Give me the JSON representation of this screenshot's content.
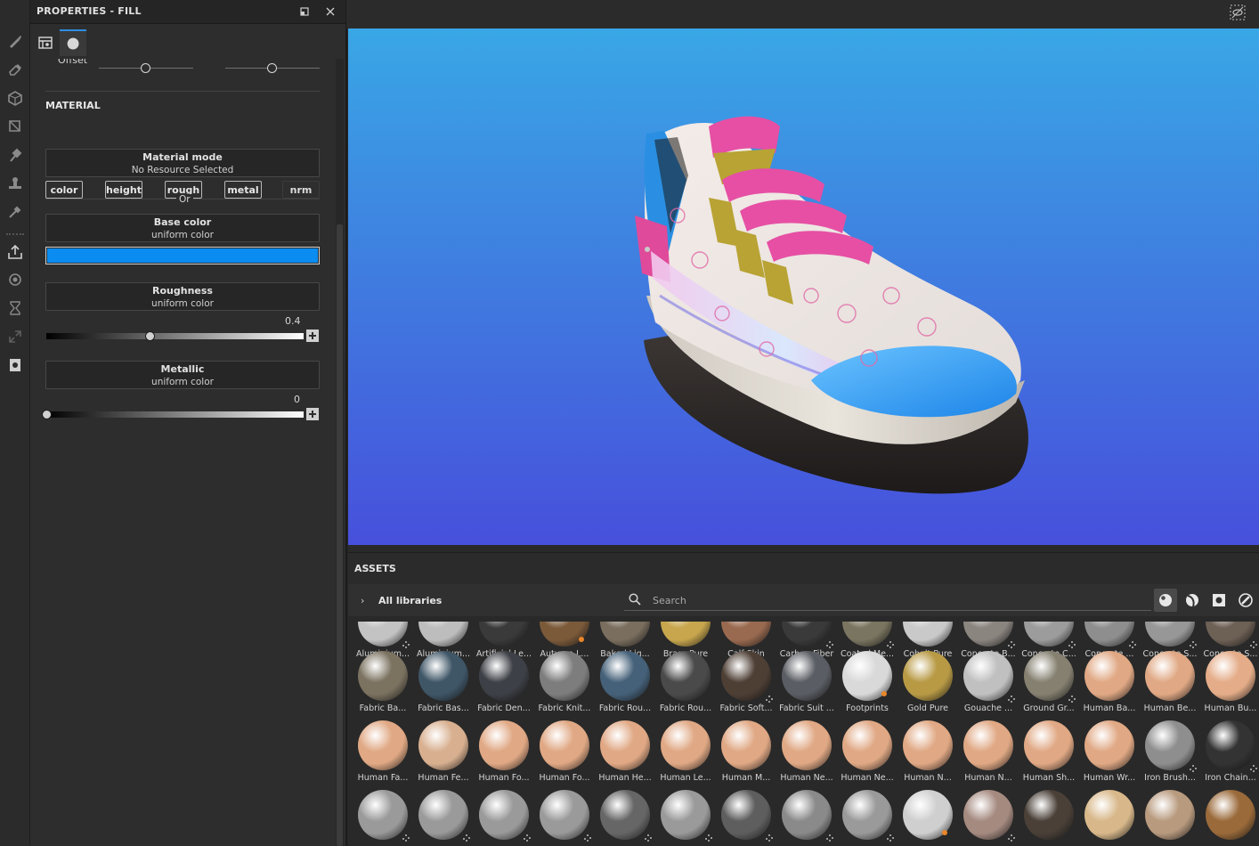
{
  "app": {
    "left_toolbar": [
      "brush-icon",
      "eraser-icon",
      "projection-icon",
      "polygon-fill-icon",
      "smudge-icon",
      "clone-stamp-icon",
      "color-picker-icon",
      "export-icon",
      "bake-icon",
      "history-icon",
      "link-icon",
      "shelf-icon"
    ]
  },
  "properties": {
    "title": "PROPERTIES - FILL",
    "offset_label": "Offset",
    "material_title": "MATERIAL",
    "channels": [
      {
        "label": "color",
        "active": true
      },
      {
        "label": "height",
        "active": true
      },
      {
        "label": "rough",
        "active": true
      },
      {
        "label": "metal",
        "active": true
      },
      {
        "label": "nrm",
        "active": false
      }
    ],
    "material_mode": {
      "title": "Material mode",
      "subtitle": "No Resource Selected"
    },
    "or_label": "Or",
    "base_color": {
      "title": "Base color",
      "subtitle": "uniform color",
      "swatch": "#0a8cf0"
    },
    "roughness": {
      "title": "Roughness",
      "subtitle": "uniform color",
      "value": "0.4",
      "level": 0.4
    },
    "metallic": {
      "title": "Metallic",
      "subtitle": "uniform color",
      "value": "0",
      "level": 0
    }
  },
  "assets": {
    "title": "ASSETS",
    "library_label": "All libraries",
    "search_placeholder": "Search",
    "view_modes": [
      "material-view-icon",
      "smart-material-view-icon",
      "texture-view-icon",
      "brush-view-icon"
    ],
    "rows": [
      [
        {
          "name": "Aluminium...",
          "color": "#c3c3c3",
          "dots": true
        },
        {
          "name": "Aluminium...",
          "color": "#bdbdbd"
        },
        {
          "name": "Artificial Le...",
          "color": "#3a3a3a"
        },
        {
          "name": "Autumn L...",
          "color": "#7b5a3a",
          "badge": true
        },
        {
          "name": "Baked Lig...",
          "color": "#7a6e5e"
        },
        {
          "name": "Brass Pure",
          "color": "#c7a64d"
        },
        {
          "name": "Calf Skin",
          "color": "#9a6a50"
        },
        {
          "name": "Carbon Fiber",
          "color": "#3a3a3a",
          "dots": true
        },
        {
          "name": "Coated Me...",
          "color": "#7a7560",
          "dots": true
        },
        {
          "name": "Cobalt Pure",
          "color": "#c9c9c9"
        },
        {
          "name": "Concrete B...",
          "color": "#8b8580",
          "dots": true
        },
        {
          "name": "Concrete C...",
          "color": "#9c9c9c",
          "dots": true
        },
        {
          "name": "Concrete ...",
          "color": "#8e8e8e",
          "dots": true
        },
        {
          "name": "Concrete S...",
          "color": "#979797",
          "dots": true
        },
        {
          "name": "Concrete S...",
          "color": "#6d6055",
          "dots": true
        }
      ],
      [
        {
          "name": "Fabric Ba...",
          "color": "#7b7260"
        },
        {
          "name": "Fabric Bas...",
          "color": "#3f5667"
        },
        {
          "name": "Fabric Den...",
          "color": "#3d4046"
        },
        {
          "name": "Fabric Knit...",
          "color": "#7d7d7d"
        },
        {
          "name": "Fabric Rou...",
          "color": "#456179"
        },
        {
          "name": "Fabric Rou...",
          "color": "#4a4a4a"
        },
        {
          "name": "Fabric Soft...",
          "color": "#4e3f35",
          "dots": true
        },
        {
          "name": "Fabric Suit ...",
          "color": "#5a5d63"
        },
        {
          "name": "Footprints",
          "color": "#d9d9d9",
          "badge": true
        },
        {
          "name": "Gold Pure",
          "color": "#b89a45"
        },
        {
          "name": "Gouache ...",
          "color": "#c0c0c0",
          "dots": true
        },
        {
          "name": "Ground Gr...",
          "color": "#858070",
          "dots": true
        },
        {
          "name": "Human Ba...",
          "color": "#e0a884"
        },
        {
          "name": "Human Be...",
          "color": "#e0a884"
        },
        {
          "name": "Human Bu...",
          "color": "#e4ac88"
        }
      ],
      [
        {
          "name": "Human Fa...",
          "color": "#e0a884"
        },
        {
          "name": "Human Fe...",
          "color": "#d8b090"
        },
        {
          "name": "Human Fo...",
          "color": "#e0a884"
        },
        {
          "name": "Human Fo...",
          "color": "#e0a884"
        },
        {
          "name": "Human He...",
          "color": "#e0a884"
        },
        {
          "name": "Human Le...",
          "color": "#e0a884"
        },
        {
          "name": "Human M...",
          "color": "#e0a884"
        },
        {
          "name": "Human Ne...",
          "color": "#e0a884"
        },
        {
          "name": "Human Ne...",
          "color": "#e0a884"
        },
        {
          "name": "Human N...",
          "color": "#e0a884"
        },
        {
          "name": "Human N...",
          "color": "#e0a884"
        },
        {
          "name": "Human Sh...",
          "color": "#e0a884"
        },
        {
          "name": "Human Wr...",
          "color": "#e0a884"
        },
        {
          "name": "Iron Brush...",
          "color": "#8e8e8e",
          "dots": true
        },
        {
          "name": "Iron Chain...",
          "color": "#333333",
          "dots": true
        }
      ],
      [
        {
          "name": "",
          "color": "#9a9a9a",
          "dots": true
        },
        {
          "name": "",
          "color": "#9a9a9a",
          "dots": true
        },
        {
          "name": "",
          "color": "#9a9a9a",
          "dots": true
        },
        {
          "name": "",
          "color": "#9a9a9a",
          "dots": true
        },
        {
          "name": "",
          "color": "#666666",
          "dots": true
        },
        {
          "name": "",
          "color": "#9a9a9a",
          "dots": true
        },
        {
          "name": "",
          "color": "#5e5e5e",
          "dots": true
        },
        {
          "name": "",
          "color": "#8a8a8a",
          "dots": true
        },
        {
          "name": "",
          "color": "#9a9a9a",
          "dots": true
        },
        {
          "name": "",
          "color": "#cfcfcf",
          "badge": true
        },
        {
          "name": "",
          "color": "#a58a80",
          "dots": true
        },
        {
          "name": "",
          "color": "#4a4038"
        },
        {
          "name": "",
          "color": "#d8b88a"
        },
        {
          "name": "",
          "color": "#b89a7e"
        },
        {
          "name": "",
          "color": "#9a6a3a"
        }
      ]
    ]
  }
}
